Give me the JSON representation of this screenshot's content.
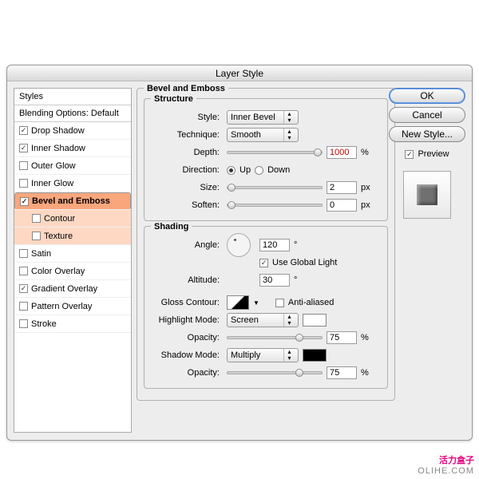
{
  "title": "Layer Style",
  "sidebar": {
    "header": "Styles",
    "blending": "Blending Options: Default",
    "items": [
      {
        "label": "Drop Shadow",
        "checked": true
      },
      {
        "label": "Inner Shadow",
        "checked": true
      },
      {
        "label": "Outer Glow",
        "checked": false
      },
      {
        "label": "Inner Glow",
        "checked": false
      },
      {
        "label": "Bevel and Emboss",
        "checked": true,
        "selected": true
      },
      {
        "label": "Contour",
        "checked": false,
        "sub": true
      },
      {
        "label": "Texture",
        "checked": false,
        "sub": true
      },
      {
        "label": "Satin",
        "checked": false
      },
      {
        "label": "Color Overlay",
        "checked": false
      },
      {
        "label": "Gradient Overlay",
        "checked": true
      },
      {
        "label": "Pattern Overlay",
        "checked": false
      },
      {
        "label": "Stroke",
        "checked": false
      }
    ]
  },
  "panel_title": "Bevel and Emboss",
  "structure": {
    "legend": "Structure",
    "style_label": "Style:",
    "style_value": "Inner Bevel",
    "technique_label": "Technique:",
    "technique_value": "Smooth",
    "depth_label": "Depth:",
    "depth_value": "1000",
    "depth_unit": "%",
    "direction_label": "Direction:",
    "up": "Up",
    "down": "Down",
    "size_label": "Size:",
    "size_value": "2",
    "size_unit": "px",
    "soften_label": "Soften:",
    "soften_value": "0",
    "soften_unit": "px"
  },
  "shading": {
    "legend": "Shading",
    "angle_label": "Angle:",
    "angle_value": "120",
    "angle_unit": "°",
    "global": "Use Global Light",
    "altitude_label": "Altitude:",
    "altitude_value": "30",
    "altitude_unit": "°",
    "gloss_label": "Gloss Contour:",
    "anti": "Anti-aliased",
    "highlight_label": "Highlight Mode:",
    "highlight_value": "Screen",
    "highlight_color": "#ffffff",
    "h_opacity_label": "Opacity:",
    "h_opacity_value": "75",
    "h_opacity_unit": "%",
    "shadow_label": "Shadow Mode:",
    "shadow_value": "Multiply",
    "shadow_color": "#000000",
    "s_opacity_label": "Opacity:",
    "s_opacity_value": "75",
    "s_opacity_unit": "%"
  },
  "buttons": {
    "ok": "OK",
    "cancel": "Cancel",
    "new_style": "New Style...",
    "preview": "Preview"
  },
  "watermark": {
    "cn": "活力盒子",
    "en": "OLIHE.COM"
  }
}
